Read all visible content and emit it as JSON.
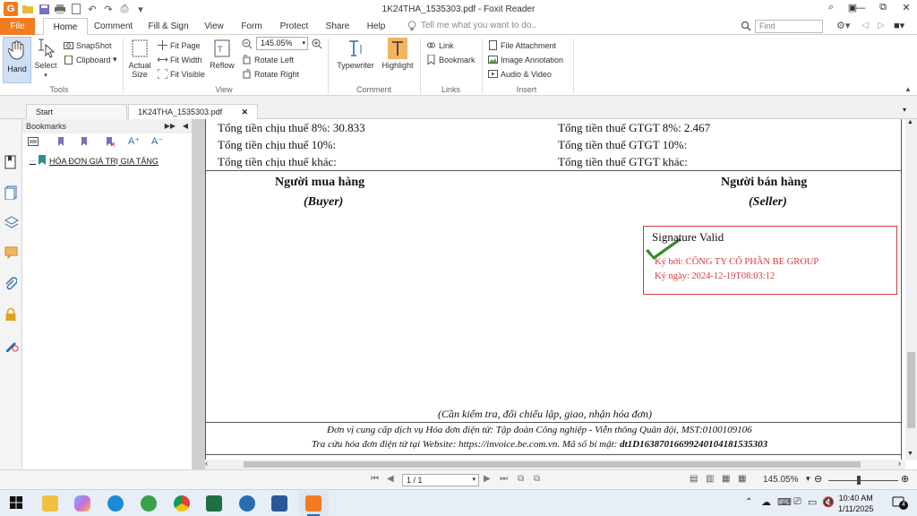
{
  "window": {
    "title": "1K24THA_1535303.pdf - Foxit Reader",
    "app_logo_letter": "G"
  },
  "menu": {
    "file": "File",
    "tabs": [
      "Home",
      "Comment",
      "Fill & Sign",
      "View",
      "Form",
      "Protect",
      "Share",
      "Help"
    ],
    "tell_me": "Tell me what you want to do..",
    "find_placeholder": "Find"
  },
  "ribbon": {
    "tools": {
      "hand": "Hand",
      "select": "Select",
      "snapshot": "SnapShot",
      "clipboard": "Clipboard",
      "label": "Tools"
    },
    "view": {
      "actual_size_1": "Actual",
      "actual_size_2": "Size",
      "fit_page": "Fit Page",
      "fit_width": "Fit Width",
      "fit_visible": "Fit Visible",
      "reflow": "Reflow",
      "zoom_value": "145.05%",
      "rotate_left": "Rotate Left",
      "rotate_right": "Rotate Right",
      "label": "View"
    },
    "comment": {
      "typewriter": "Typewriter",
      "highlight": "Highlight",
      "label": "Comment"
    },
    "links": {
      "link": "Link",
      "bookmark": "Bookmark",
      "label": "Links"
    },
    "insert": {
      "file_attachment": "File Attachment",
      "image_annotation": "Image Annotation",
      "audio_video": "Audio & Video",
      "label": "Insert"
    }
  },
  "doc_tabs": [
    {
      "label": "Start"
    },
    {
      "label": "1K24THA_1535303.pdf"
    }
  ],
  "bookmarks": {
    "header": "Bookmarks",
    "item": "HÓA ĐƠN GIÁ TRỊ GIA TĂNG"
  },
  "pdf": {
    "tax_rows": [
      {
        "left": "Tổng tiền chịu thuế 8%: 30.833",
        "right": "Tổng tiền thuế GTGT 8%: 2.467"
      },
      {
        "left": "Tổng tiền chịu thuế 10%:",
        "right": "Tổng tiền thuế GTGT 10%:"
      },
      {
        "left": "Tổng tiền chịu thuế khác:",
        "right": "Tổng tiền thuế GTGT khác:"
      }
    ],
    "buyer_title": "Người mua hàng",
    "buyer_en": "(Buyer)",
    "seller_title": "Người bán hàng",
    "seller_en": "(Seller)",
    "signature": {
      "status": "Signature Valid",
      "signed_by": "Ký bởi: CÔNG TY CỔ PHẦN BE GROUP",
      "signed_date": "Ký ngày: 2024-12-19T08:03:12"
    },
    "check_note": "(Cần kiểm tra, đối chiếu lập, giao, nhận hóa đơn)",
    "provider": "Đơn vị cung cấp dịch vụ Hóa đơn điện tử: Tập đoàn Công nghiệp - Viễn thông Quân đội, MST:0100109106",
    "lookup_prefix": "Tra cứu hóa đơn điện tử tại Website: https://invoice.be.com.vn. Mã số bí mật: ",
    "secret_code": "dt1D16387016699240104181535303"
  },
  "status": {
    "page": "1 / 1",
    "zoom": "145.05%"
  },
  "taskbar": {
    "time": "10:40 AM",
    "date": "1/11/2025",
    "notifications": "4"
  },
  "colors": {
    "accent": "#f47b20",
    "signature_red": "#d43a3a",
    "signature_check": "#3c8a2e"
  }
}
